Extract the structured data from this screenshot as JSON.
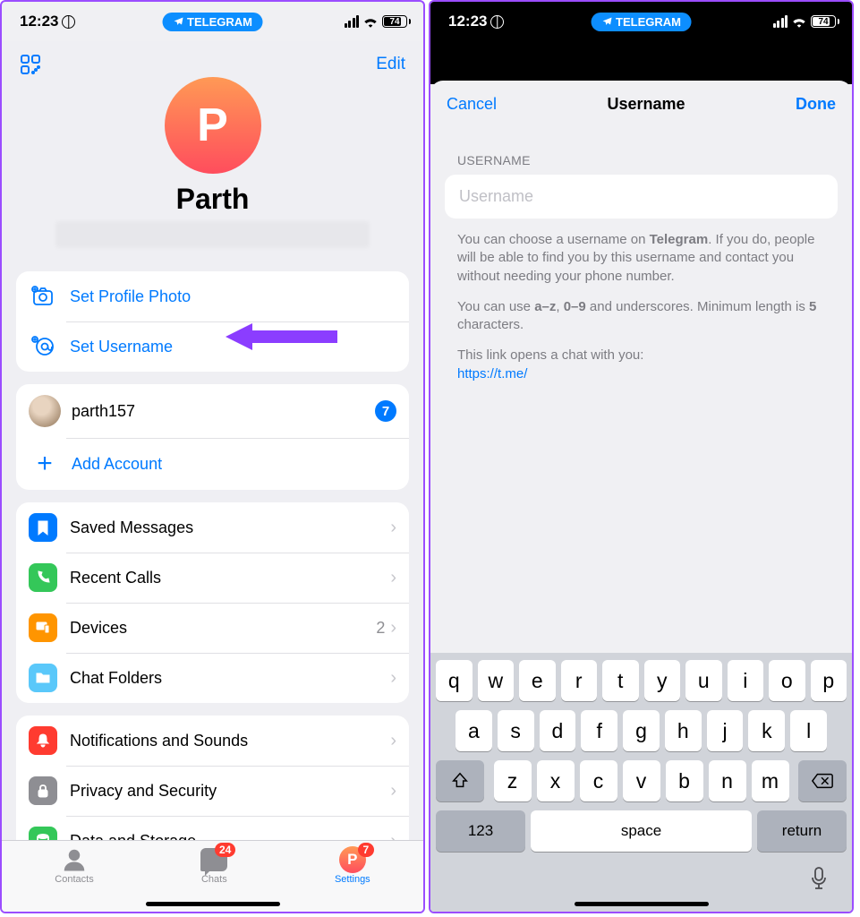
{
  "status": {
    "time": "12:23",
    "pill": "TELEGRAM",
    "battery": "74"
  },
  "left": {
    "edit": "Edit",
    "avatar_letter": "P",
    "name": "Parth",
    "profile_actions": {
      "set_photo": "Set Profile Photo",
      "set_username": "Set Username"
    },
    "accounts": {
      "current": "parth157",
      "badge": "7",
      "add": "Add Account"
    },
    "menu1": {
      "saved": "Saved Messages",
      "calls": "Recent Calls",
      "devices": "Devices",
      "devices_count": "2",
      "folders": "Chat Folders"
    },
    "menu2": {
      "notif": "Notifications and Sounds",
      "privacy": "Privacy and Security",
      "storage": "Data and Storage"
    },
    "tabs": {
      "contacts": "Contacts",
      "chats": "Chats",
      "chats_badge": "24",
      "settings": "Settings",
      "settings_badge": "7",
      "settings_letter": "P"
    }
  },
  "right": {
    "cancel": "Cancel",
    "title": "Username",
    "done": "Done",
    "section": "USERNAME",
    "placeholder": "Username",
    "help1a": "You can choose a username on ",
    "help1b": "Telegram",
    "help1c": ". If you do, people will be able to find you by this username and contact you without needing your phone number.",
    "help2a": "You can use ",
    "help2b": "a–z",
    "help2c": ", ",
    "help2d": "0–9",
    "help2e": " and underscores. Minimum length is ",
    "help2f": "5",
    "help2g": " characters.",
    "help3": "This link opens a chat with you:",
    "link": "https://t.me/",
    "keyboard": {
      "row1": [
        "q",
        "w",
        "e",
        "r",
        "t",
        "y",
        "u",
        "i",
        "o",
        "p"
      ],
      "row2": [
        "a",
        "s",
        "d",
        "f",
        "g",
        "h",
        "j",
        "k",
        "l"
      ],
      "row3": [
        "z",
        "x",
        "c",
        "v",
        "b",
        "n",
        "m"
      ],
      "num": "123",
      "space": "space",
      "return": "return"
    }
  }
}
